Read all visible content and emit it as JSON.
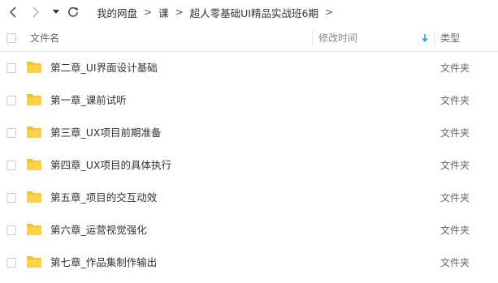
{
  "toolbar": {
    "back_icon": "back-arrow-icon",
    "forward_icon": "forward-arrow-icon",
    "dropdown_icon": "dropdown-caret-icon",
    "refresh_icon": "refresh-icon"
  },
  "breadcrumb": {
    "items": [
      "我的网盘",
      "课",
      "超人零基础UI精品实战班6期"
    ],
    "separator": ">"
  },
  "table": {
    "header": {
      "name": "文件名",
      "modified": "修改时间",
      "type": "类型",
      "sort_icon": "sort-down-arrow-icon"
    },
    "rows": [
      {
        "name": "第二章_UI界面设计基础",
        "type": "文件夹"
      },
      {
        "name": "第一章_课前试听",
        "type": "文件夹"
      },
      {
        "name": "第三章_UX项目前期准备",
        "type": "文件夹"
      },
      {
        "name": "第四章_UX项目的具体执行",
        "type": "文件夹"
      },
      {
        "name": "第五章_项目的交互动效",
        "type": "文件夹"
      },
      {
        "name": "第六章_运营视觉强化",
        "type": "文件夹"
      },
      {
        "name": "第七章_作品集制作输出",
        "type": "文件夹"
      }
    ]
  },
  "colors": {
    "folder": "#fdd248",
    "folder_tab": "#f6c232",
    "sort_arrow": "#2da6e8",
    "icon": "#555555"
  }
}
